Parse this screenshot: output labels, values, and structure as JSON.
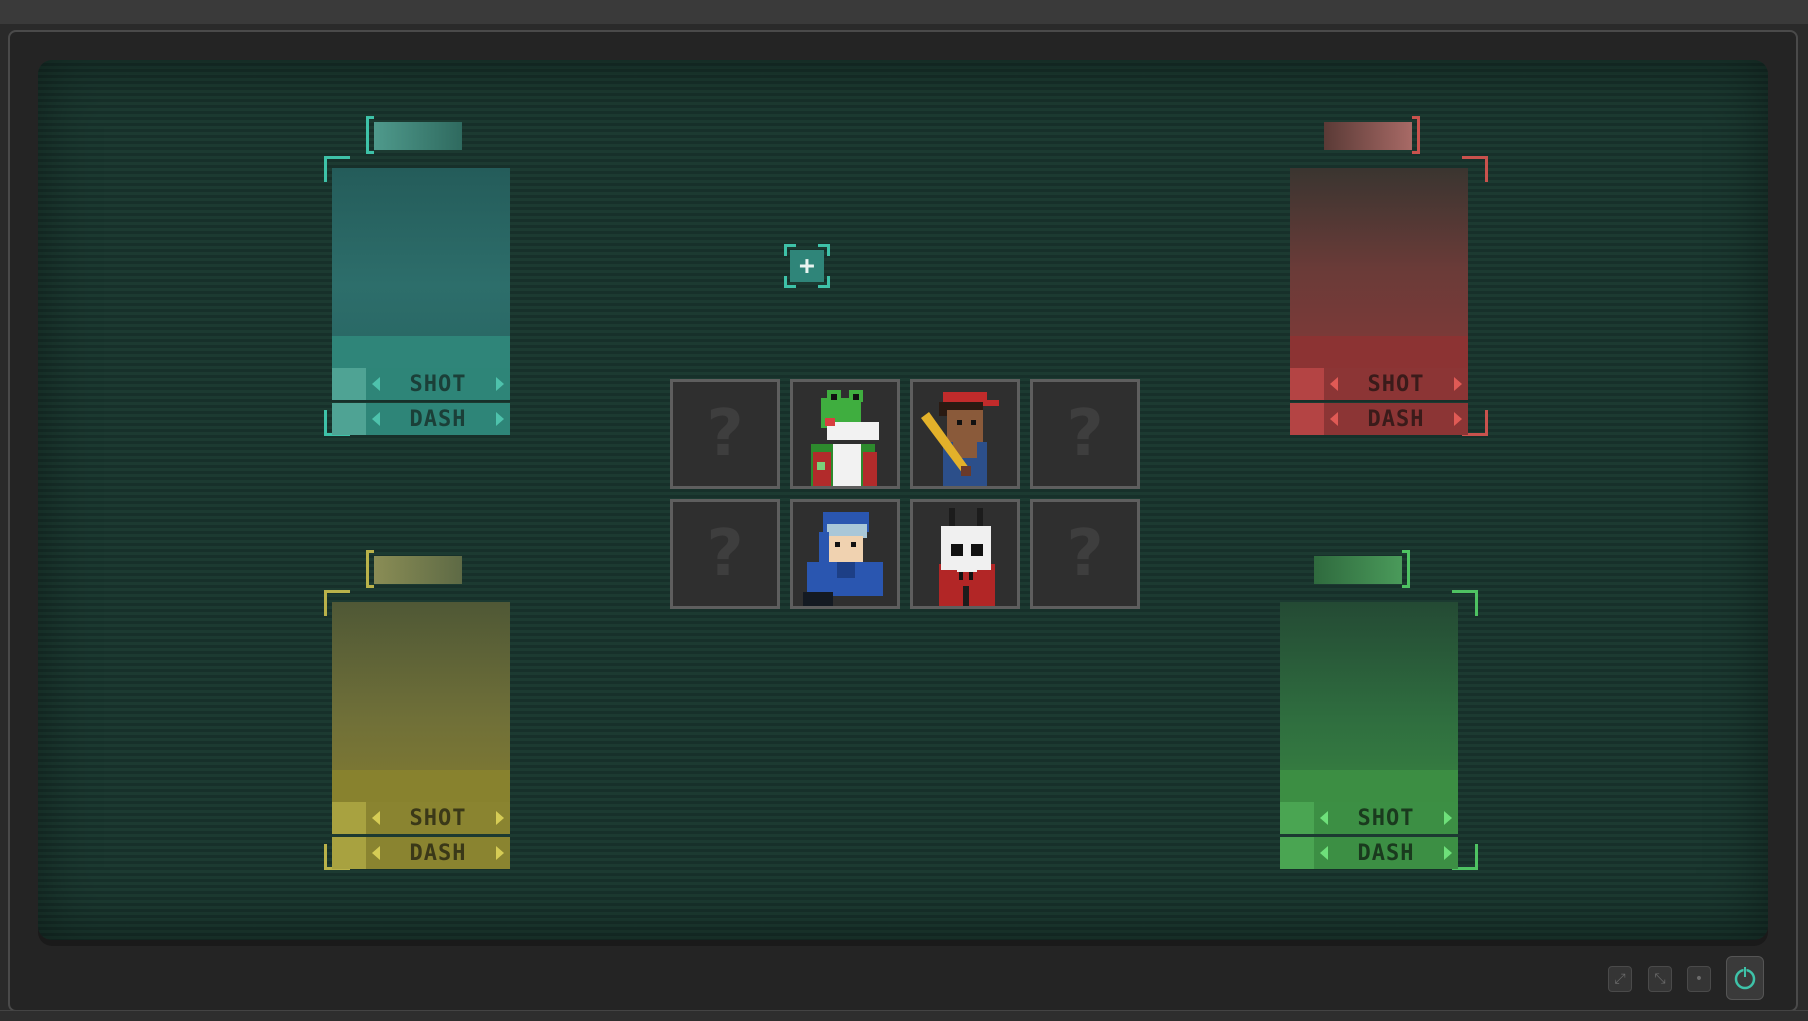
{
  "players": [
    {
      "id": "p1",
      "color": "teal",
      "options": [
        {
          "label": "SHOT"
        },
        {
          "label": "DASH"
        }
      ]
    },
    {
      "id": "p2",
      "color": "red",
      "options": [
        {
          "label": "SHOT"
        },
        {
          "label": "DASH"
        }
      ]
    },
    {
      "id": "p3",
      "color": "yellow",
      "options": [
        {
          "label": "SHOT"
        },
        {
          "label": "DASH"
        }
      ]
    },
    {
      "id": "p4",
      "color": "green",
      "options": [
        {
          "label": "SHOT"
        },
        {
          "label": "DASH"
        }
      ]
    }
  ],
  "cursor": {
    "symbol": "+"
  },
  "character_grid": {
    "cells": [
      {
        "type": "locked",
        "glyph": "?"
      },
      {
        "type": "character",
        "icon": "frog-character-icon"
      },
      {
        "type": "character",
        "icon": "bat-kid-character-icon"
      },
      {
        "type": "locked",
        "glyph": "?"
      },
      {
        "type": "locked",
        "glyph": "?"
      },
      {
        "type": "character",
        "icon": "knight-character-icon"
      },
      {
        "type": "character",
        "icon": "skull-character-icon"
      },
      {
        "type": "locked",
        "glyph": "?"
      }
    ]
  },
  "system_buttons": [
    {
      "icon": "expand-icon"
    },
    {
      "icon": "shrink-icon"
    },
    {
      "icon": "dot-icon"
    },
    {
      "icon": "power-icon"
    }
  ]
}
